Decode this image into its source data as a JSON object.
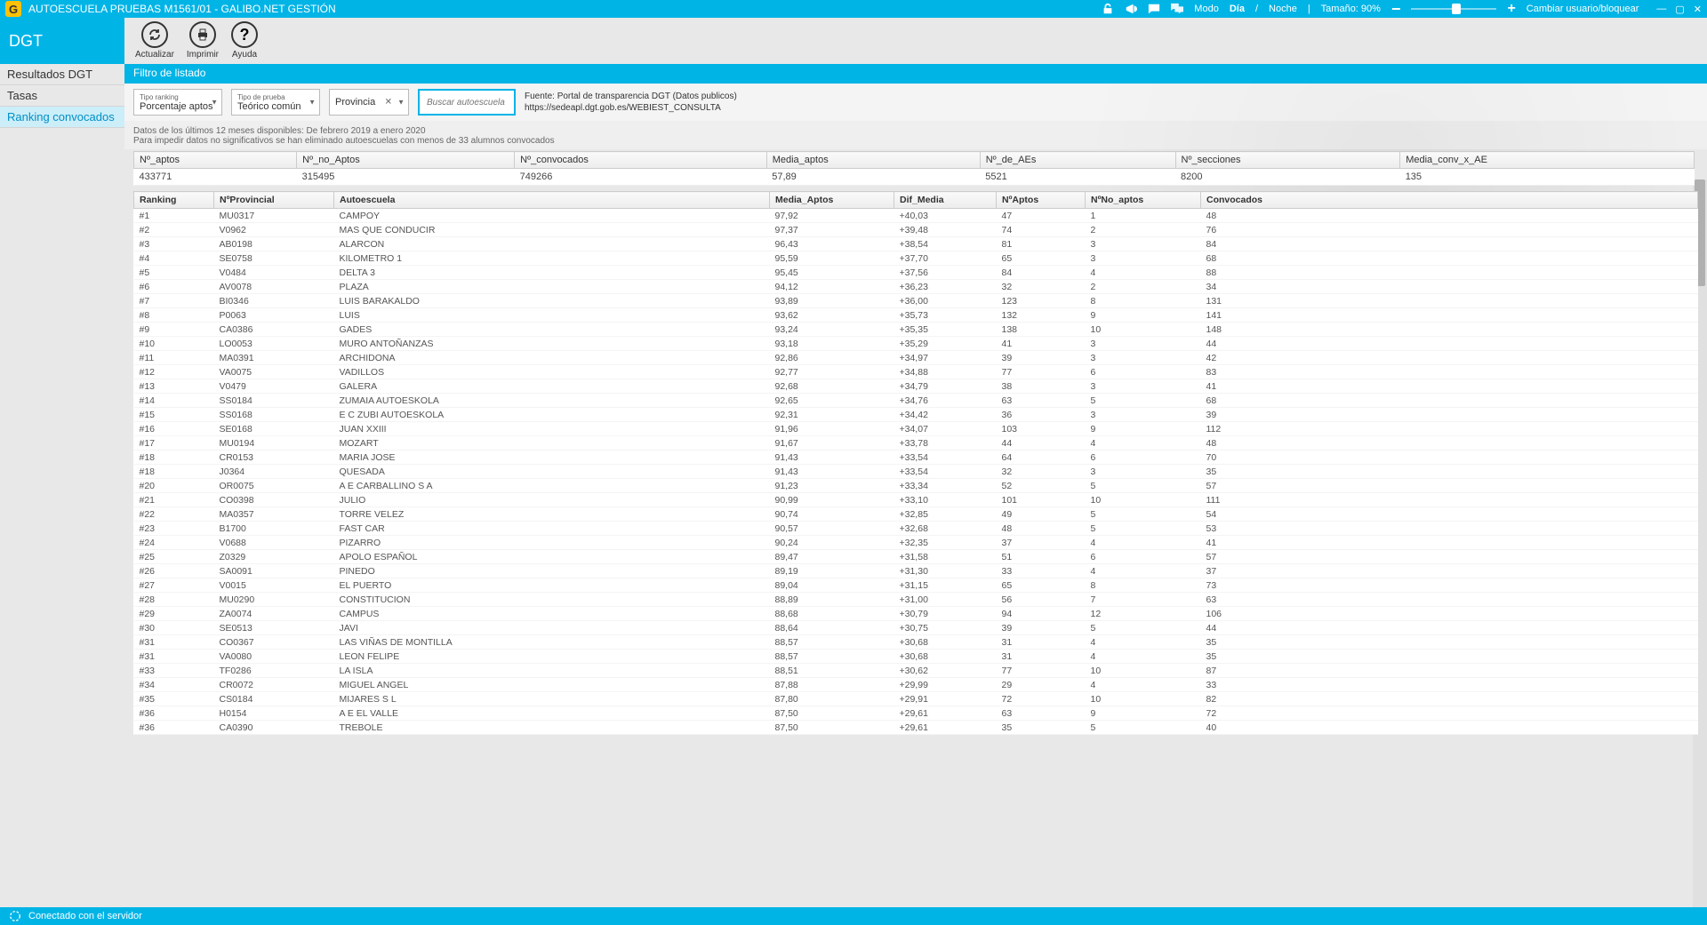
{
  "titlebar": {
    "title": "AUTOESCUELA PRUEBAS M1561/01 - GALIBO.NET GESTIÓN",
    "mode_label": "Modo",
    "mode_day": "Día",
    "mode_sep": "/",
    "mode_night": "Noche",
    "size_label": "Tamaño: 90%",
    "change_user": "Cambiar usuario/bloquear"
  },
  "sidebar": {
    "header": "DGT",
    "items": [
      {
        "label": "Resultados DGT"
      },
      {
        "label": "Tasas"
      },
      {
        "label": "Ranking convocados"
      }
    ]
  },
  "toolbar": {
    "refresh": "Actualizar",
    "print": "Imprimir",
    "help": "Ayuda"
  },
  "filter": {
    "title": "Filtro de listado",
    "ranking_label": "Tipo ranking",
    "ranking_value": "Porcentaje aptos",
    "test_label": "Tipo de prueba",
    "test_value": "Teórico común",
    "province_label": "Provincia",
    "search_placeholder": "Buscar autoescuela",
    "source_line1": "Fuente: Portal de transparencia DGT (Datos publicos)",
    "source_line2": "https://sedeapl.dgt.gob.es/WEBIEST_CONSULTA"
  },
  "info": {
    "line1": "Datos de los últimos 12 meses disponibles: De febrero 2019 a enero 2020",
    "line2": "Para impedir datos no significativos se han eliminado autoescuelas con menos de 33 alumnos convocados"
  },
  "summary": {
    "headers": [
      "Nº_aptos",
      "Nº_no_Aptos",
      "Nº_convocados",
      "Media_aptos",
      "Nº_de_AEs",
      "Nº_secciones",
      "Media_conv_x_AE"
    ],
    "values": [
      "433771",
      "315495",
      "749266",
      "57,89",
      "5521",
      "8200",
      "135"
    ]
  },
  "table": {
    "headers": [
      "Ranking",
      "NºProvincial",
      "Autoescuela",
      "Media_Aptos",
      "Dif_Media",
      "NºAptos",
      "NºNo_aptos",
      "Convocados"
    ],
    "rows": [
      [
        "#1",
        "MU0317",
        "CAMPOY",
        "97,92",
        "+40,03",
        "47",
        "1",
        "48"
      ],
      [
        "#2",
        "V0962",
        "MAS QUE CONDUCIR",
        "97,37",
        "+39,48",
        "74",
        "2",
        "76"
      ],
      [
        "#3",
        "AB0198",
        "ALARCON",
        "96,43",
        "+38,54",
        "81",
        "3",
        "84"
      ],
      [
        "#4",
        "SE0758",
        "KILOMETRO 1",
        "95,59",
        "+37,70",
        "65",
        "3",
        "68"
      ],
      [
        "#5",
        "V0484",
        "DELTA 3",
        "95,45",
        "+37,56",
        "84",
        "4",
        "88"
      ],
      [
        "#6",
        "AV0078",
        "PLAZA",
        "94,12",
        "+36,23",
        "32",
        "2",
        "34"
      ],
      [
        "#7",
        "BI0346",
        "LUIS BARAKALDO",
        "93,89",
        "+36,00",
        "123",
        "8",
        "131"
      ],
      [
        "#8",
        "P0063",
        "LUIS",
        "93,62",
        "+35,73",
        "132",
        "9",
        "141"
      ],
      [
        "#9",
        "CA0386",
        "GADES",
        "93,24",
        "+35,35",
        "138",
        "10",
        "148"
      ],
      [
        "#10",
        "LO0053",
        "MURO ANTOÑANZAS",
        "93,18",
        "+35,29",
        "41",
        "3",
        "44"
      ],
      [
        "#11",
        "MA0391",
        "ARCHIDONA",
        "92,86",
        "+34,97",
        "39",
        "3",
        "42"
      ],
      [
        "#12",
        "VA0075",
        "VADILLOS",
        "92,77",
        "+34,88",
        "77",
        "6",
        "83"
      ],
      [
        "#13",
        "V0479",
        "GALERA",
        "92,68",
        "+34,79",
        "38",
        "3",
        "41"
      ],
      [
        "#14",
        "SS0184",
        "ZUMAIA AUTOESKOLA",
        "92,65",
        "+34,76",
        "63",
        "5",
        "68"
      ],
      [
        "#15",
        "SS0168",
        "E C ZUBI AUTOESKOLA",
        "92,31",
        "+34,42",
        "36",
        "3",
        "39"
      ],
      [
        "#16",
        "SE0168",
        "JUAN XXIII",
        "91,96",
        "+34,07",
        "103",
        "9",
        "112"
      ],
      [
        "#17",
        "MU0194",
        "MOZART",
        "91,67",
        "+33,78",
        "44",
        "4",
        "48"
      ],
      [
        "#18",
        "CR0153",
        "MARIA JOSE",
        "91,43",
        "+33,54",
        "64",
        "6",
        "70"
      ],
      [
        "#18",
        "J0364",
        "QUESADA",
        "91,43",
        "+33,54",
        "32",
        "3",
        "35"
      ],
      [
        "#20",
        "OR0075",
        "A E CARBALLINO S A",
        "91,23",
        "+33,34",
        "52",
        "5",
        "57"
      ],
      [
        "#21",
        "CO0398",
        "JULIO",
        "90,99",
        "+33,10",
        "101",
        "10",
        "111"
      ],
      [
        "#22",
        "MA0357",
        "TORRE VELEZ",
        "90,74",
        "+32,85",
        "49",
        "5",
        "54"
      ],
      [
        "#23",
        "B1700",
        "FAST CAR",
        "90,57",
        "+32,68",
        "48",
        "5",
        "53"
      ],
      [
        "#24",
        "V0688",
        "PIZARRO",
        "90,24",
        "+32,35",
        "37",
        "4",
        "41"
      ],
      [
        "#25",
        "Z0329",
        "APOLO ESPAÑOL",
        "89,47",
        "+31,58",
        "51",
        "6",
        "57"
      ],
      [
        "#26",
        "SA0091",
        "PINEDO",
        "89,19",
        "+31,30",
        "33",
        "4",
        "37"
      ],
      [
        "#27",
        "V0015",
        "EL PUERTO",
        "89,04",
        "+31,15",
        "65",
        "8",
        "73"
      ],
      [
        "#28",
        "MU0290",
        "CONSTITUCION",
        "88,89",
        "+31,00",
        "56",
        "7",
        "63"
      ],
      [
        "#29",
        "ZA0074",
        "CAMPUS",
        "88,68",
        "+30,79",
        "94",
        "12",
        "106"
      ],
      [
        "#30",
        "SE0513",
        "JAVI",
        "88,64",
        "+30,75",
        "39",
        "5",
        "44"
      ],
      [
        "#31",
        "CO0367",
        "LAS VIÑAS DE MONTILLA",
        "88,57",
        "+30,68",
        "31",
        "4",
        "35"
      ],
      [
        "#31",
        "VA0080",
        "LEON FELIPE",
        "88,57",
        "+30,68",
        "31",
        "4",
        "35"
      ],
      [
        "#33",
        "TF0286",
        "LA ISLA",
        "88,51",
        "+30,62",
        "77",
        "10",
        "87"
      ],
      [
        "#34",
        "CR0072",
        "MIGUEL ANGEL",
        "87,88",
        "+29,99",
        "29",
        "4",
        "33"
      ],
      [
        "#35",
        "CS0184",
        "MIJARES S L",
        "87,80",
        "+29,91",
        "72",
        "10",
        "82"
      ],
      [
        "#36",
        "H0154",
        "A E EL VALLE",
        "87,50",
        "+29,61",
        "63",
        "9",
        "72"
      ],
      [
        "#36",
        "CA0390",
        "TREBOLE",
        "87,50",
        "+29,61",
        "35",
        "5",
        "40"
      ]
    ]
  },
  "statusbar": {
    "text": "Conectado con el servidor"
  }
}
